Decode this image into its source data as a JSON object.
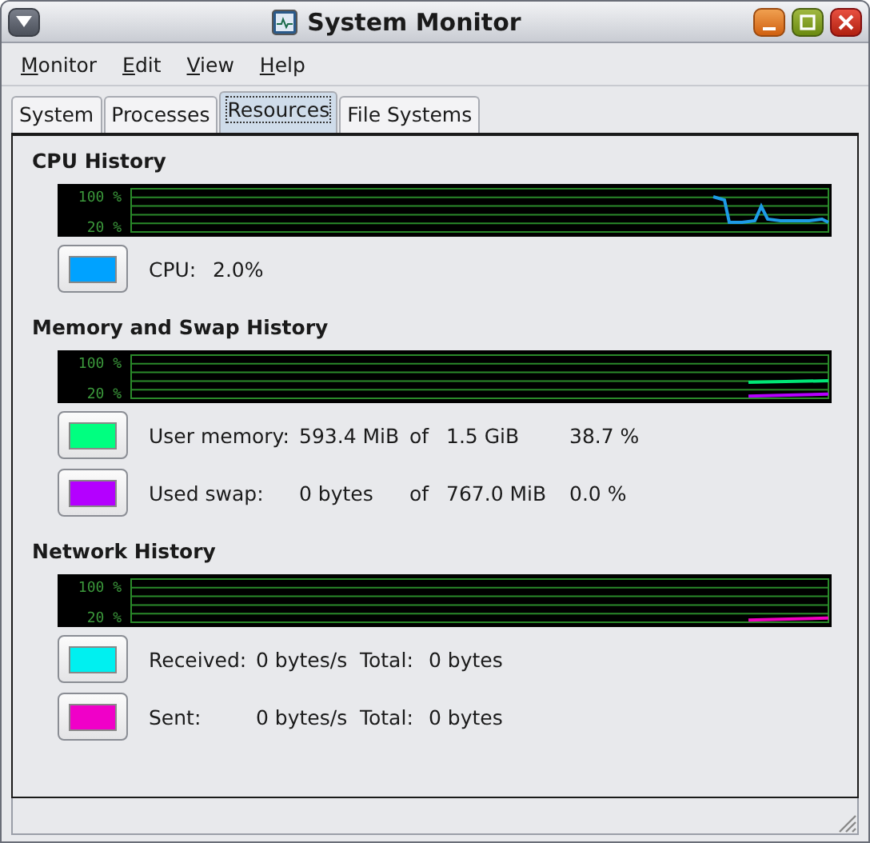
{
  "window": {
    "title": "System Monitor"
  },
  "menu": [
    "Monitor",
    "Edit",
    "View",
    "Help"
  ],
  "tabs": [
    {
      "label": "System",
      "selected": false
    },
    {
      "label": "Processes",
      "selected": false
    },
    {
      "label": "Resources",
      "selected": true
    },
    {
      "label": "File Systems",
      "selected": false
    }
  ],
  "sections": [
    {
      "title": "CPU History",
      "kind": "cpu",
      "graph": {
        "axis_labels": [
          "100 %",
          "20 %"
        ],
        "traces": [
          {
            "color": "#1e9be6",
            "kind": "spike"
          }
        ]
      },
      "rows": [
        {
          "color": "#00a2ff",
          "cells": [
            "CPU:",
            "2.0%"
          ]
        }
      ]
    },
    {
      "title": "Memory and Swap History",
      "kind": "memory",
      "graph": {
        "axis_labels": [
          "100 %",
          "20 %"
        ],
        "traces": [
          {
            "color": "#00e676",
            "kind": "mid"
          },
          {
            "color": "#b400ff",
            "kind": "low"
          }
        ]
      },
      "rows": [
        {
          "color": "#00ff80",
          "cells": [
            "User memory:",
            "593.4 MiB",
            "of",
            "1.5 GiB",
            "38.7 %"
          ]
        },
        {
          "color": "#b400ff",
          "cells": [
            "Used swap:",
            "0 bytes",
            "of",
            "767.0 MiB",
            "0.0 %"
          ]
        }
      ]
    },
    {
      "title": "Network History",
      "kind": "network",
      "graph": {
        "axis_labels": [
          "100 %",
          "20 %"
        ],
        "traces": [
          {
            "color": "#f000c0",
            "kind": "low"
          }
        ]
      },
      "rows": [
        {
          "color": "#00f0f0",
          "cells": [
            "Received:",
            "0 bytes/s",
            "Total:",
            "0 bytes"
          ]
        },
        {
          "color": "#f000c8",
          "cells": [
            "Sent:",
            "0 bytes/s",
            "Total:",
            "0 bytes"
          ]
        }
      ]
    }
  ]
}
